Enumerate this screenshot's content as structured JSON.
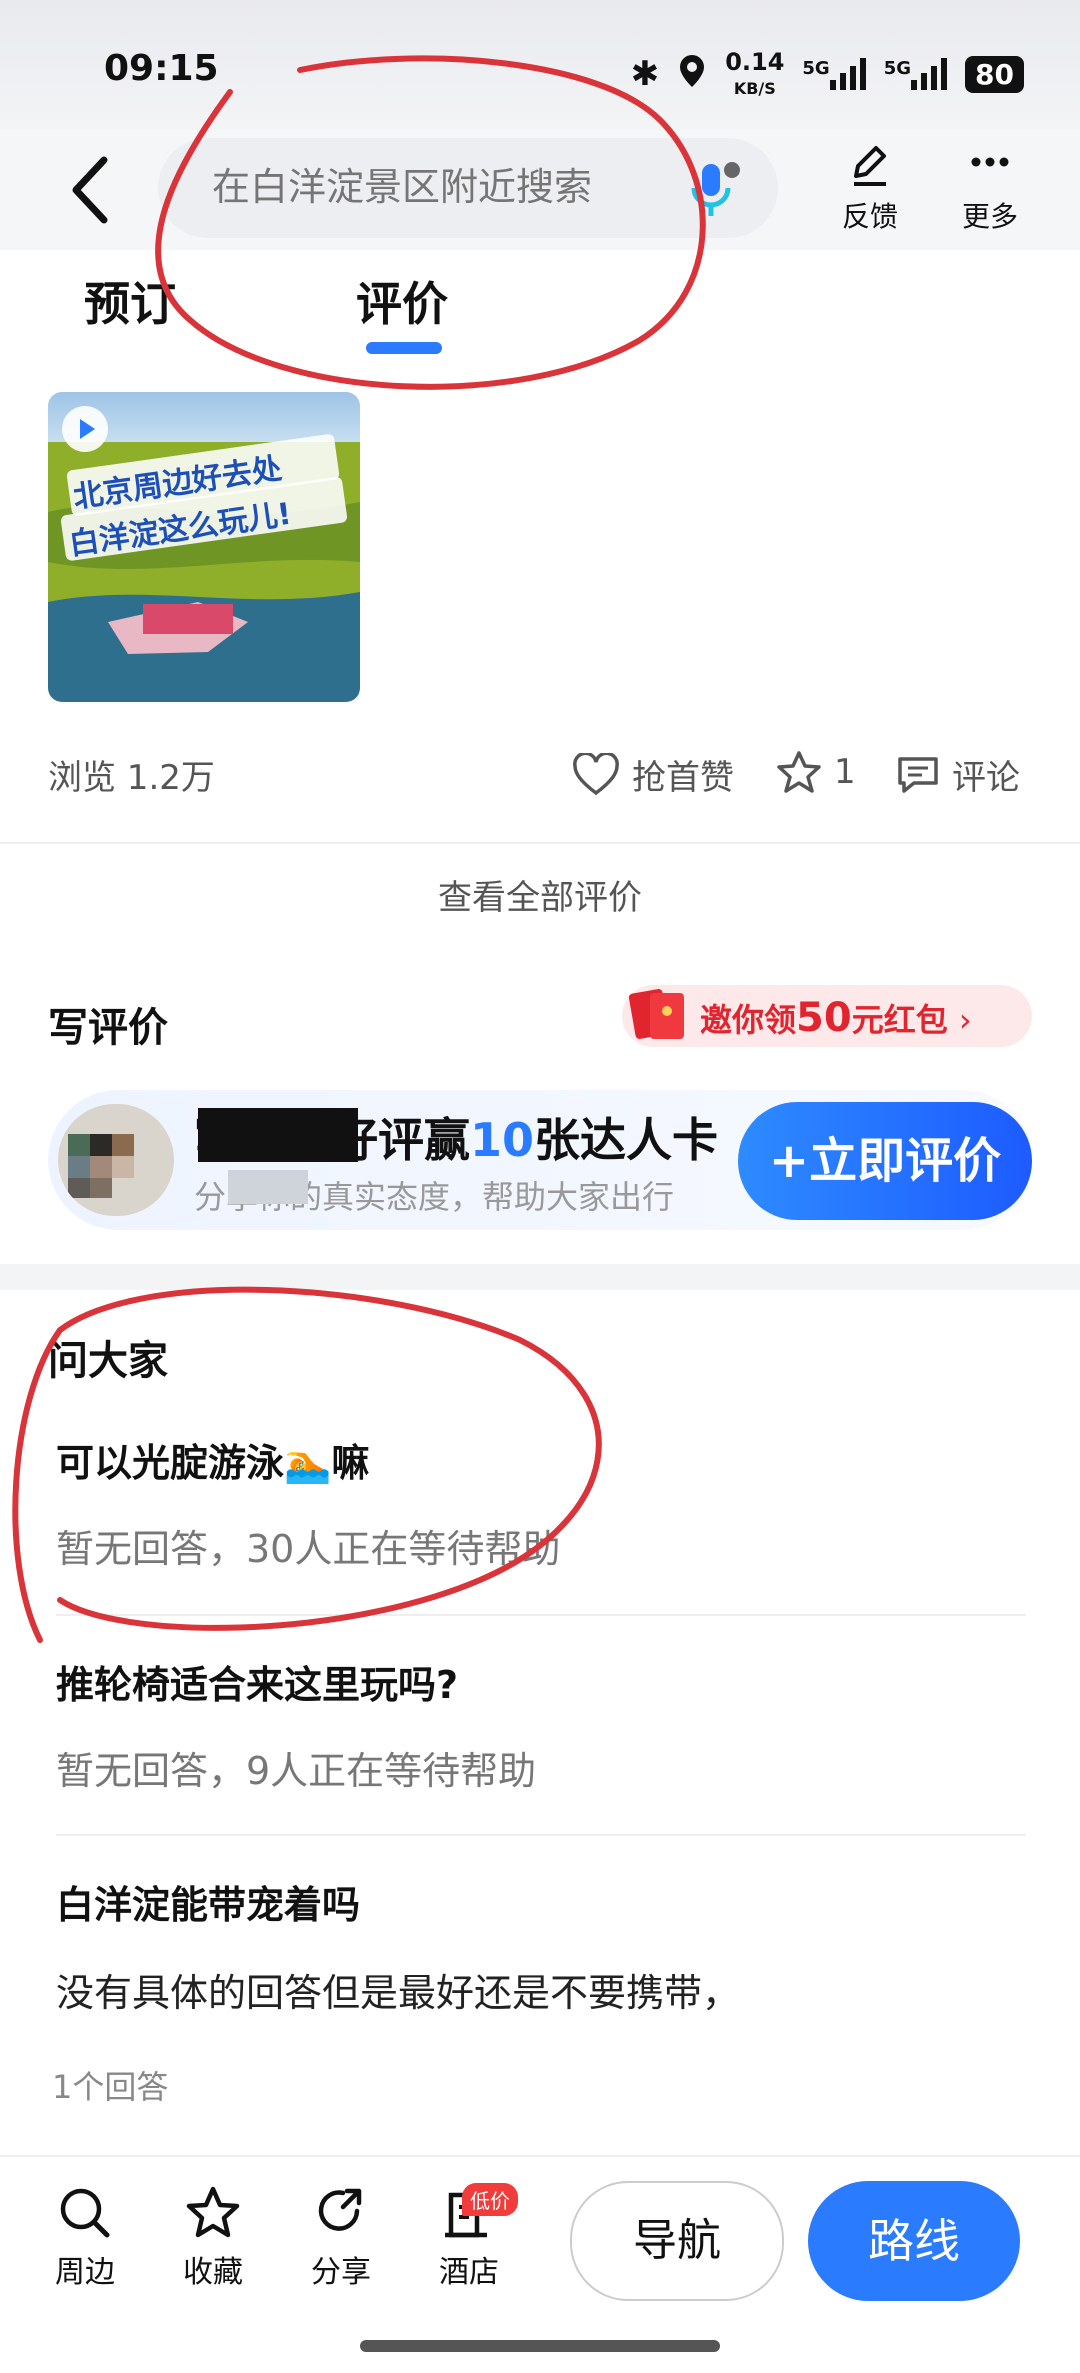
{
  "status_bar": {
    "time": "09:15",
    "net_speed_top": "0.14",
    "net_speed_unit": "KB/S",
    "sig1": "5G",
    "sig2": "5G",
    "battery": "80"
  },
  "header": {
    "search_placeholder": "在白洋淀景区附近搜索",
    "feedback_label": "反馈",
    "more_label": "更多"
  },
  "tabs": [
    {
      "label": "预订"
    },
    {
      "label": "评价"
    }
  ],
  "media": {
    "thumbnail_text_line1": "北京周边好去处",
    "thumbnail_text_line2": "白洋淀这么玩儿!"
  },
  "stats": {
    "views": "浏览 1.2万",
    "like_label": "抢首赞",
    "star_count": "1",
    "comment_label": "评论"
  },
  "view_all": "查看全部评价",
  "write_review": {
    "title": "写评价",
    "red_packet_prefix": "邀你领",
    "red_packet_amount": "50",
    "red_packet_suffix": "元红包",
    "card_title_prefix": "写真实好评赢",
    "card_title_num": "10",
    "card_title_suffix": "张达人卡",
    "card_subtitle": "分享你的真实态度，帮助大家出行",
    "button_label": "+立即评价"
  },
  "qa": {
    "title": "问大家",
    "items": [
      {
        "question": "可以光腚游泳🏊嘛",
        "answer": "暂无回答，30人正在等待帮助"
      },
      {
        "question": "推轮椅适合来这里玩吗?",
        "answer": "暂无回答，9人正在等待帮助"
      },
      {
        "question": "白洋淀能带宠着吗",
        "answer": "没有具体的回答但是最好还是不要携带，",
        "count": "1个回答"
      }
    ]
  },
  "bottom_bar": {
    "items": [
      {
        "label": "周边"
      },
      {
        "label": "收藏"
      },
      {
        "label": "分享"
      },
      {
        "label": "酒店"
      }
    ],
    "hotel_badge": "低价",
    "nav_label": "导航",
    "route_label": "路线"
  },
  "colors": {
    "accent": "#2b7bff",
    "red": "#e1252f",
    "annotation": "#d9343a"
  }
}
